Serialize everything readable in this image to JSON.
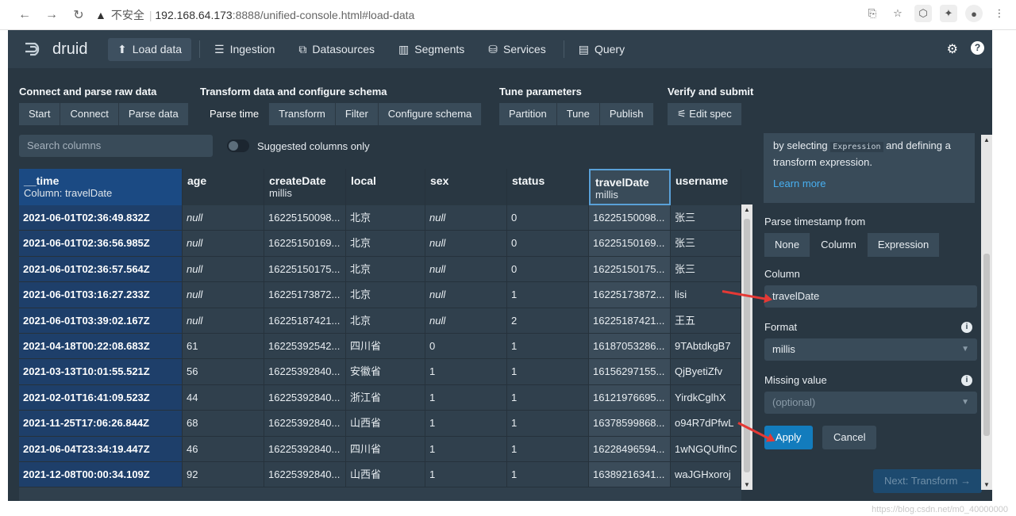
{
  "browser": {
    "insecure_label": "不安全",
    "url_host": "192.168.64.173",
    "url_rest": ":8888/unified-console.html#load-data"
  },
  "nav": {
    "logo": "druid",
    "items": [
      {
        "label": "Load data",
        "icon": "cloud-upload-icon"
      },
      {
        "label": "Ingestion",
        "icon": "gantt-icon"
      },
      {
        "label": "Datasources",
        "icon": "datasources-icon"
      },
      {
        "label": "Segments",
        "icon": "stacked-chart-icon"
      },
      {
        "label": "Services",
        "icon": "database-icon"
      },
      {
        "label": "Query",
        "icon": "application-icon"
      }
    ]
  },
  "steps": {
    "groups": [
      {
        "title": "Connect and parse raw data",
        "buttons": [
          "Start",
          "Connect",
          "Parse data"
        ]
      },
      {
        "title": "Transform data and configure schema",
        "buttons": [
          "Parse time",
          "Transform",
          "Filter",
          "Configure schema"
        ]
      },
      {
        "title": "Tune parameters",
        "buttons": [
          "Partition",
          "Tune",
          "Publish"
        ]
      },
      {
        "title": "Verify and submit",
        "buttons": [
          "Edit spec"
        ]
      }
    ]
  },
  "tools": {
    "search_placeholder": "Search columns",
    "toggle_label": "Suggested columns only"
  },
  "table": {
    "headers": [
      {
        "name": "__time",
        "sub": "Column: travelDate"
      },
      {
        "name": "age",
        "sub": ""
      },
      {
        "name": "createDate",
        "sub": "millis"
      },
      {
        "name": "local",
        "sub": ""
      },
      {
        "name": "sex",
        "sub": ""
      },
      {
        "name": "status",
        "sub": ""
      },
      {
        "name": "travelDate",
        "sub": "millis"
      },
      {
        "name": "username",
        "sub": ""
      }
    ],
    "rows": [
      [
        "2021-06-01T02:36:49.832Z",
        "null",
        "16225150098...",
        "北京",
        "null",
        "0",
        "16225150098...",
        "张三"
      ],
      [
        "2021-06-01T02:36:56.985Z",
        "null",
        "16225150169...",
        "北京",
        "null",
        "0",
        "16225150169...",
        "张三"
      ],
      [
        "2021-06-01T02:36:57.564Z",
        "null",
        "16225150175...",
        "北京",
        "null",
        "0",
        "16225150175...",
        "张三"
      ],
      [
        "2021-06-01T03:16:27.233Z",
        "null",
        "16225173872...",
        "北京",
        "null",
        "1",
        "16225173872...",
        "lisi"
      ],
      [
        "2021-06-01T03:39:02.167Z",
        "null",
        "16225187421...",
        "北京",
        "null",
        "2",
        "16225187421...",
        "王五"
      ],
      [
        "2021-04-18T00:22:08.683Z",
        "61",
        "16225392542...",
        "四川省",
        "0",
        "1",
        "16187053286...",
        "9TAbtdkgB7"
      ],
      [
        "2021-03-13T10:01:55.521Z",
        "56",
        "16225392840...",
        "安徽省",
        "1",
        "1",
        "16156297155...",
        "QjByetiZfv"
      ],
      [
        "2021-02-01T16:41:09.523Z",
        "44",
        "16225392840...",
        "浙江省",
        "1",
        "1",
        "16121976695...",
        "YirdkCglhX"
      ],
      [
        "2021-11-25T17:06:26.844Z",
        "68",
        "16225392840...",
        "山西省",
        "1",
        "1",
        "16378599868...",
        "o94R7dPfwL"
      ],
      [
        "2021-06-04T23:34:19.447Z",
        "46",
        "16225392840...",
        "四川省",
        "1",
        "1",
        "16228496594...",
        "1wNGQUflnC"
      ],
      [
        "2021-12-08T00:00:34.109Z",
        "92",
        "16225392840...",
        "山西省",
        "1",
        "1",
        "16389216341...",
        "waJGHxoroj"
      ]
    ]
  },
  "panel": {
    "callout_text_before": "by selecting",
    "callout_code": "Expression",
    "callout_text_after": "and defining a transform expression.",
    "learn_more": "Learn more",
    "parse_from_label": "Parse timestamp from",
    "parse_options": [
      "None",
      "Column",
      "Expression"
    ],
    "column_label": "Column",
    "column_value": "travelDate",
    "format_label": "Format",
    "format_value": "millis",
    "missing_label": "Missing value",
    "missing_placeholder": "(optional)",
    "apply": "Apply",
    "cancel": "Cancel",
    "next": "Next: Transform →"
  },
  "watermark": "https://blog.csdn.net/m0_40000000"
}
